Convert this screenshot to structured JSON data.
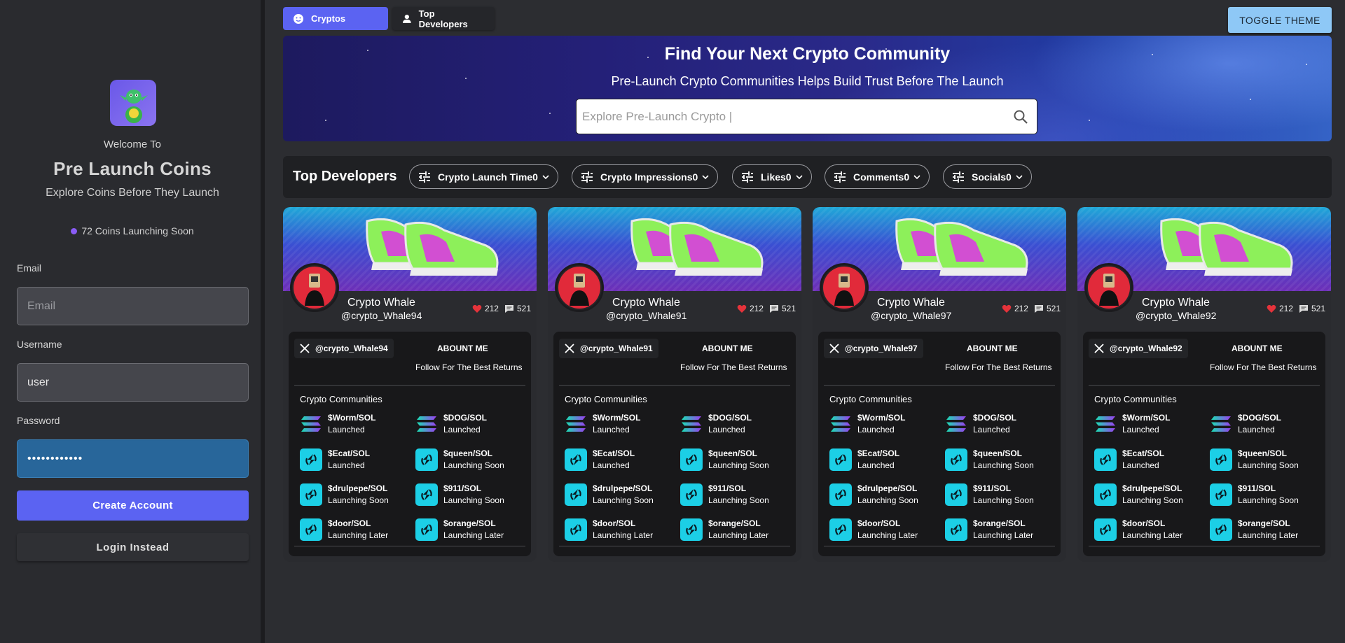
{
  "sidebar": {
    "welcome": "Welcome To",
    "title": "Pre Launch Coins",
    "subtitle": "Explore Coins Before They Launch",
    "launching_text": "72 Coins Launching Soon",
    "email_label": "Email",
    "email_placeholder": "Email",
    "username_label": "Username",
    "username_value": "user",
    "password_label": "Password",
    "password_value": "••••••••••••",
    "create_account": "Create Account",
    "login_instead": "Login Instead"
  },
  "tabs": [
    {
      "label": "Cryptos",
      "icon": "smiley-icon",
      "active": true
    },
    {
      "label": "Top Developers",
      "icon": "person-icon",
      "active": false
    }
  ],
  "toggle_theme": "TOGGLE THEME",
  "hero": {
    "title": "Find Your Next Crypto Community",
    "subtitle": "Pre-Launch Crypto Communities Helps Build Trust Before The Launch",
    "search_placeholder": "Explore Pre-Launch Crypto |"
  },
  "filters": {
    "title": "Top Developers",
    "chips": [
      "Crypto Launch Time0",
      "Crypto Impressions0",
      "Likes0",
      "Comments0",
      "Socials0"
    ]
  },
  "cards": [
    {
      "name": "Crypto Whale",
      "handle": "@crypto_Whale94",
      "likes": "212",
      "comments": "521",
      "x_handle": "@crypto_Whale94",
      "about_heading": "ABOUNT ME",
      "about_text": "Follow For The Best Returns",
      "communities_heading": "Crypto Communities"
    },
    {
      "name": "Crypto Whale",
      "handle": "@crypto_Whale91",
      "likes": "212",
      "comments": "521",
      "x_handle": "@crypto_Whale91",
      "about_heading": "ABOUNT ME",
      "about_text": "Follow For The Best Returns",
      "communities_heading": "Crypto Communities"
    },
    {
      "name": "Crypto Whale",
      "handle": "@crypto_Whale97",
      "likes": "212",
      "comments": "521",
      "x_handle": "@crypto_Whale97",
      "about_heading": "ABOUNT ME",
      "about_text": "Follow For The Best Returns",
      "communities_heading": "Crypto Communities"
    },
    {
      "name": "Crypto Whale",
      "handle": "@crypto_Whale92",
      "likes": "212",
      "comments": "521",
      "x_handle": "@crypto_Whale92",
      "about_heading": "ABOUNT ME",
      "about_text": "Follow For The Best Returns",
      "communities_heading": "Crypto Communities"
    }
  ],
  "coins": [
    {
      "name": "$Worm/SOL",
      "status": "Launched",
      "icon": "solana-icon"
    },
    {
      "name": "$DOG/SOL",
      "status": "Launched",
      "icon": "solana-icon"
    },
    {
      "name": "$Ecat/SOL",
      "status": "Launched",
      "icon": "ecat-icon"
    },
    {
      "name": "$queen/SOL",
      "status": "Launching Soon",
      "icon": "ecat-icon"
    },
    {
      "name": "$drulpepe/SOL",
      "status": "Launching Soon",
      "icon": "ecat-icon"
    },
    {
      "name": "$911/SOL",
      "status": "Launching Soon",
      "icon": "ecat-icon"
    },
    {
      "name": "$door/SOL",
      "status": "Launching Later",
      "icon": "ecat-icon"
    },
    {
      "name": "$orange/SOL",
      "status": "Launching Later",
      "icon": "ecat-icon"
    }
  ],
  "colors": {
    "accent": "#5b63f2",
    "toggle": "#8ec8f6",
    "like": "#e5333b",
    "coin_teal": "#1ccfe6"
  }
}
